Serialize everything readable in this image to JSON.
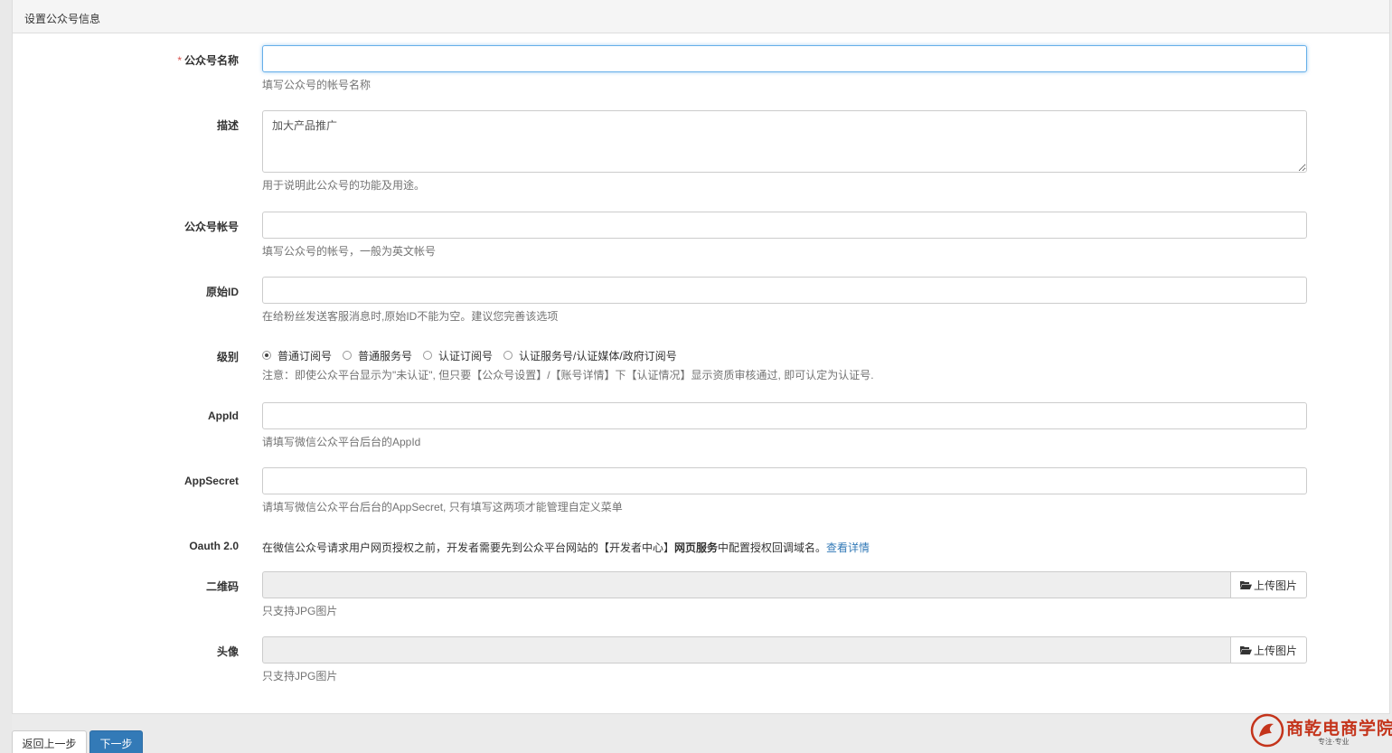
{
  "panel": {
    "heading": "设置公众号信息"
  },
  "fields": {
    "name": {
      "label": "公众号名称",
      "required_mark": "*",
      "value": "",
      "help": "填写公众号的帐号名称"
    },
    "description": {
      "label": "描述",
      "value": "加大产品推广",
      "help": "用于说明此公众号的功能及用途。"
    },
    "account": {
      "label": "公众号帐号",
      "value": "",
      "help": "填写公众号的帐号，一般为英文帐号"
    },
    "original_id": {
      "label": "原始ID",
      "value": "",
      "help": "在给粉丝发送客服消息时,原始ID不能为空。建议您完善该选项"
    },
    "level": {
      "label": "级别",
      "options": [
        "普通订阅号",
        "普通服务号",
        "认证订阅号",
        "认证服务号/认证媒体/政府订阅号"
      ],
      "selected": "普通订阅号",
      "help": "注意：即使公众平台显示为\"未认证\", 但只要【公众号设置】/【账号详情】下【认证情况】显示资质审核通过, 即可认定为认证号."
    },
    "appid": {
      "label": "AppId",
      "value": "",
      "help": "请填写微信公众平台后台的AppId"
    },
    "appsecret": {
      "label": "AppSecret",
      "value": "",
      "help": "请填写微信公众平台后台的AppSecret, 只有填写这两项才能管理自定义菜单"
    },
    "oauth": {
      "label": "Oauth 2.0",
      "text_before": "在微信公众号请求用户网页授权之前，开发者需要先到公众平台网站的【开发者中心】",
      "text_bold": "网页服务",
      "text_after": "中配置授权回调域名。",
      "link": "查看详情"
    },
    "qrcode": {
      "label": "二维码",
      "button": "上传图片",
      "help": "只支持JPG图片"
    },
    "avatar": {
      "label": "头像",
      "button": "上传图片",
      "help": "只支持JPG图片"
    }
  },
  "buttons": {
    "back": "返回上一步",
    "next": "下一步"
  },
  "watermark": {
    "title": "商乾电商学院",
    "subtitle": "专注·专业"
  },
  "colors": {
    "primary": "#337ab7",
    "required": "#d9534f",
    "link": "#337ab7",
    "watermark": "#c4341b"
  },
  "icons": {
    "upload": "folder-open-icon"
  }
}
